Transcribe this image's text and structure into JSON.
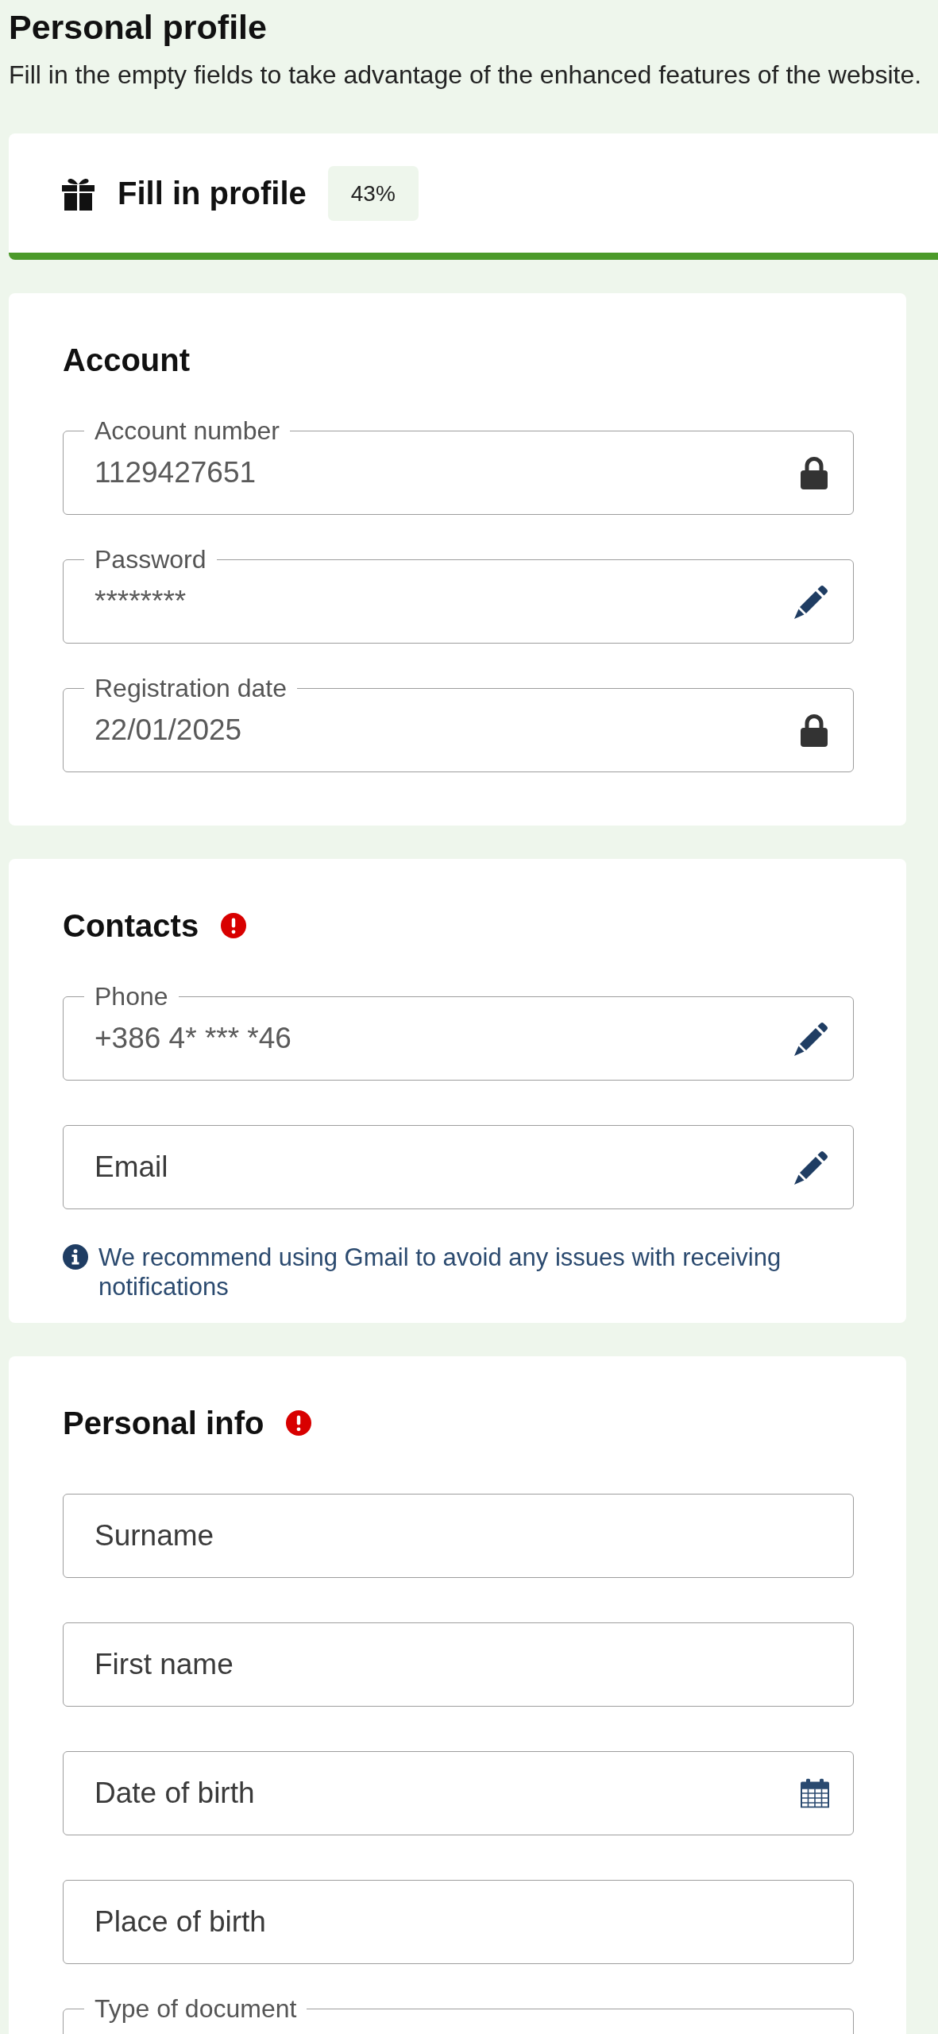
{
  "header": {
    "title": "Personal profile",
    "subtitle": "Fill in the empty fields to take advantage of the enhanced features of the website."
  },
  "progress_card": {
    "title": "Fill in profile",
    "percent": "43%"
  },
  "sections": [
    {
      "title": "Account",
      "warning": false,
      "fields": [
        {
          "kind": "locked",
          "label": "Account number",
          "value": "1129427651"
        },
        {
          "kind": "editable",
          "label": "Password",
          "value": "********"
        },
        {
          "kind": "locked",
          "label": "Registration date",
          "value": "22/01/2025"
        }
      ]
    },
    {
      "title": "Contacts",
      "warning": true,
      "fields": [
        {
          "kind": "editable",
          "label": "Phone",
          "value": "+386 4* *** *46"
        },
        {
          "kind": "editable",
          "placeholder": "Email"
        }
      ],
      "note": "We recommend using Gmail to avoid any issues with receiving notifications"
    },
    {
      "title": "Personal info",
      "warning": true,
      "fields": [
        {
          "kind": "text",
          "placeholder": "Surname"
        },
        {
          "kind": "text",
          "placeholder": "First name"
        },
        {
          "kind": "date",
          "placeholder": "Date of birth"
        },
        {
          "kind": "text",
          "placeholder": "Place of birth"
        },
        {
          "kind": "text",
          "label": "Type of document"
        }
      ]
    }
  ]
}
